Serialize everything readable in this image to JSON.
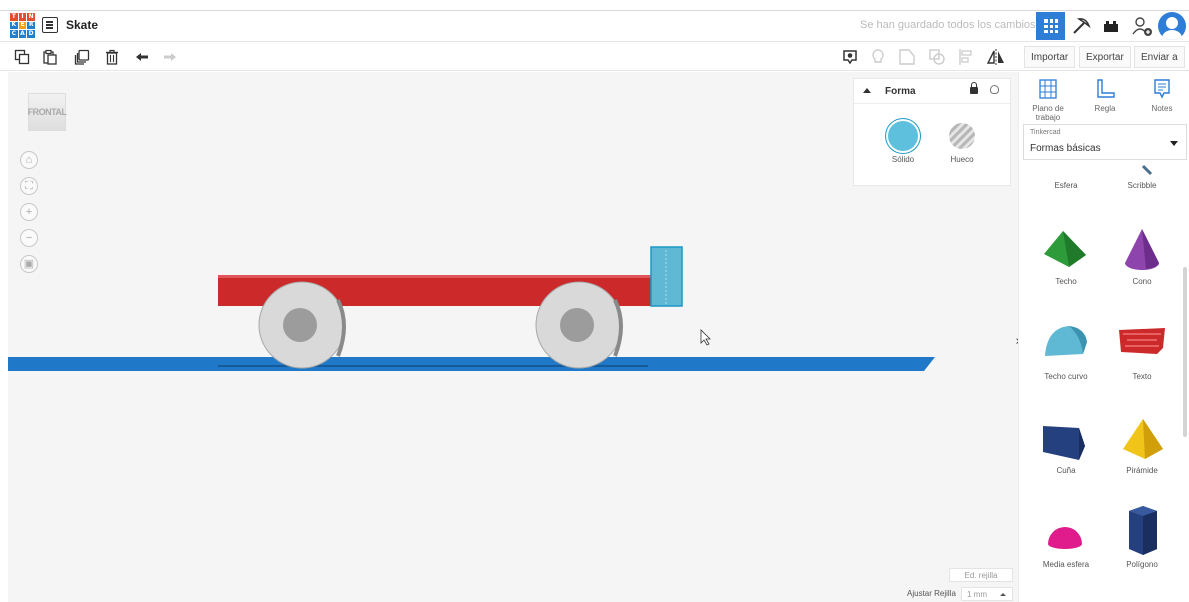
{
  "app": {
    "logo_letters": [
      "T",
      "I",
      "N",
      "K",
      "E",
      "R",
      "C",
      "A",
      "D"
    ],
    "logo_colors": [
      "#e34f2e",
      "#e34f2e",
      "#e34f2e",
      "#1f7fd1",
      "#1f7fd1",
      "#1f7fd1",
      "#1f7fd1",
      "#1f7fd1",
      "#1f7fd1"
    ],
    "project_name": "Skate",
    "save_status": "Se han guardado todos los cambios.",
    "accent_color": "#2e7dd7"
  },
  "toolbar": {
    "left_tools": [
      "copy-icon",
      "paste-icon",
      "duplicate-icon",
      "delete-icon",
      "undo-icon",
      "redo-icon"
    ],
    "right_tools": [
      "notes-visibility-icon",
      "light-bulb-icon",
      "group-icon",
      "ungroup-icon",
      "align-icon",
      "mirror-icon"
    ],
    "import_label": "Importar",
    "export_label": "Exportar",
    "send_label": "Enviar a"
  },
  "viewport": {
    "view_cube_label": "FRONTAL",
    "nav_buttons": [
      "home-icon",
      "fit-view-icon",
      "zoom-in-icon",
      "zoom-out-icon",
      "perspective-icon"
    ],
    "edit_grid_label": "Ed. rejilla",
    "snap_label": "Ajustar Rejilla",
    "snap_value": "1 mm",
    "workplane_color": "#1f78c8",
    "deck_color": "#cc2a2a",
    "wheel_color": "#d9d9d9",
    "selected_part_color": "#5fb8d4"
  },
  "inspector": {
    "title": "Forma",
    "solid_label": "Sólido",
    "hole_label": "Hueco",
    "solid_color": "#5ec0dd"
  },
  "panel": {
    "workplane_label": "Plano de trabajo",
    "ruler_label": "Regla",
    "notes_label": "Notes",
    "library_owner": "Tinkercad",
    "library_name": "Formas básicas",
    "shapes": [
      {
        "label": "Esfera"
      },
      {
        "label": "Scribble"
      },
      {
        "label": "Techo",
        "color": "#2e9b3a"
      },
      {
        "label": "Cono",
        "color": "#8e44ad"
      },
      {
        "label": "Techo curvo",
        "color": "#5fb8d4"
      },
      {
        "label": "Texto",
        "color": "#cc2a2a"
      },
      {
        "label": "Cuña",
        "color": "#24407e"
      },
      {
        "label": "Pirámide",
        "color": "#f0c419"
      },
      {
        "label": "Media esfera",
        "color": "#e01b8c"
      },
      {
        "label": "Polígono",
        "color": "#24407e"
      }
    ]
  }
}
